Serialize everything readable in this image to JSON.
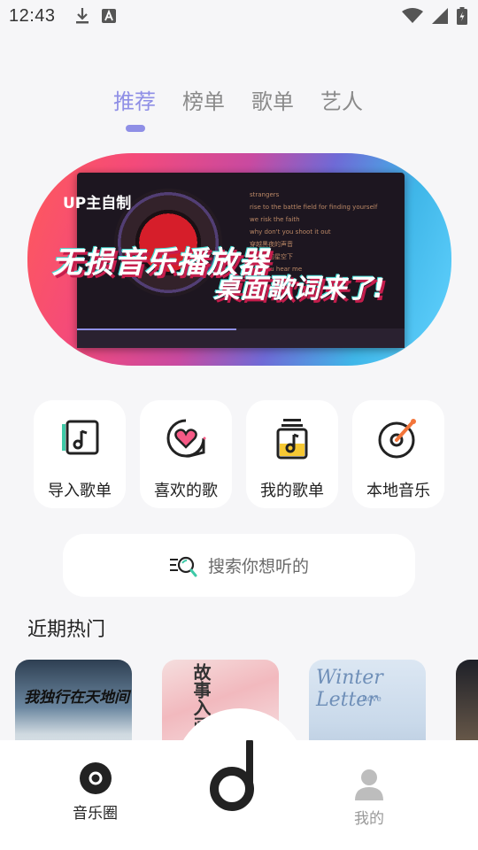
{
  "status_bar": {
    "time": "12:43",
    "left_icons": [
      "download-icon",
      "a-notification-icon"
    ],
    "right_icons": [
      "wifi-icon",
      "signal-icon",
      "battery-icon"
    ]
  },
  "tabs": [
    {
      "label": "推荐",
      "active": true
    },
    {
      "label": "榜单",
      "active": false
    },
    {
      "label": "歌单",
      "active": false
    },
    {
      "label": "艺人",
      "active": false
    }
  ],
  "banner": {
    "badge": "UP主自制",
    "headline1": "无损音乐播放器",
    "headline2": "桌面歌词来了!",
    "lyric_lines": [
      "strangers",
      "rise to the battle field for finding yourself",
      "we risk the faith",
      "why don't you shoot it out",
      "穿越黑夜的声音",
      "在满天的星空下",
      "can you hear me"
    ]
  },
  "quick_actions": [
    {
      "label": "导入歌单",
      "icon": "import-playlist-icon"
    },
    {
      "label": "喜欢的歌",
      "icon": "favorite-heart-icon"
    },
    {
      "label": "我的歌单",
      "icon": "my-playlist-icon"
    },
    {
      "label": "本地音乐",
      "icon": "local-music-disc-icon"
    }
  ],
  "search": {
    "placeholder": "搜索你想听的",
    "icon": "search-icon"
  },
  "recent": {
    "title": "近期热门",
    "covers": [
      {
        "text": "我独行在天地间"
      },
      {
        "text": "故事入画"
      },
      {
        "text": "Winter Letter",
        "sub": "Love"
      },
      {
        "text": ""
      }
    ]
  },
  "bottom_nav": {
    "items": [
      {
        "label": "音乐圈",
        "icon": "music-circle-icon",
        "active": true
      },
      {
        "label": "",
        "icon": "app-logo-icon"
      },
      {
        "label": "我的",
        "icon": "profile-icon",
        "active": false
      }
    ]
  },
  "colors": {
    "accent": "#8f8fe6",
    "background": "#f6f6f8",
    "inactive_text": "#8a8a8a"
  }
}
